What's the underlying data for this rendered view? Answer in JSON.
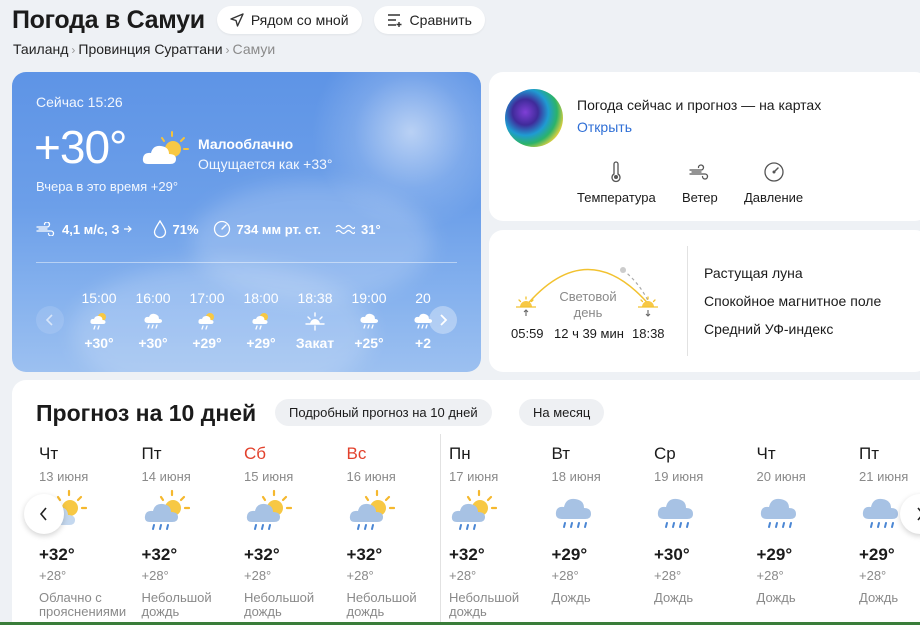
{
  "header": {
    "title": "Погода в Самуи",
    "nearby_label": "Рядом со мной",
    "compare_label": "Сравнить"
  },
  "breadcrumb": [
    "Таиланд",
    "Провинция Сураттани",
    "Самуи"
  ],
  "now": {
    "time": "Сейчас 15:26",
    "temp": "+30°",
    "condition": "Малооблачно",
    "feels_like": "Ощущается как +33°",
    "yesterday": "Вчера в это время +29°",
    "wind": "4,1 м/с, З",
    "humidity": "71%",
    "pressure": "734 мм рт. ст.",
    "water_temp": "31°",
    "hourly": [
      {
        "time": "15:00",
        "icon": "partly-cloudy-rain-icon",
        "temp": "+30°"
      },
      {
        "time": "16:00",
        "icon": "cloud-rain-icon",
        "temp": "+30°"
      },
      {
        "time": "17:00",
        "icon": "partly-cloudy-rain-icon",
        "temp": "+29°"
      },
      {
        "time": "18:00",
        "icon": "partly-cloudy-rain-icon",
        "temp": "+29°"
      },
      {
        "time": "18:38",
        "icon": "sunset-icon",
        "temp": "Закат"
      },
      {
        "time": "19:00",
        "icon": "cloud-rain-icon",
        "temp": "+25°"
      },
      {
        "time": "20",
        "icon": "cloud-rain-icon",
        "temp": "+2"
      }
    ]
  },
  "maps": {
    "title": "Погода сейчас и прогноз — на картах",
    "open_label": "Открыть",
    "layers": [
      "Температура",
      "Ветер",
      "Давление"
    ]
  },
  "sun": {
    "daylight_label": "Световой день",
    "sunrise": "05:59",
    "day_length": "12 ч 39 мин",
    "sunset": "18:38",
    "moon": "Растущая луна",
    "magnetic": "Спокойное магнитное поле",
    "uv": "Средний УФ-индекс"
  },
  "forecast": {
    "title": "Прогноз на 10 дней",
    "detailed_label": "Подробный прогноз на 10 дней",
    "month_label": "На месяц",
    "days": [
      {
        "name": "Чт",
        "date": "13 июня",
        "icon": "partly-cloudy-icon",
        "max": "+32°",
        "min": "+28°",
        "cond": "Облачно с прояснениями",
        "weekend": false
      },
      {
        "name": "Пт",
        "date": "14 июня",
        "icon": "partly-cloudy-rain-icon",
        "max": "+32°",
        "min": "+28°",
        "cond": "Небольшой дождь",
        "weekend": false
      },
      {
        "name": "Сб",
        "date": "15 июня",
        "icon": "partly-cloudy-rain-icon",
        "max": "+32°",
        "min": "+28°",
        "cond": "Небольшой дождь",
        "weekend": true
      },
      {
        "name": "Вс",
        "date": "16 июня",
        "icon": "partly-cloudy-rain-icon",
        "max": "+32°",
        "min": "+28°",
        "cond": "Небольшой дождь",
        "weekend": true
      },
      {
        "name": "Пн",
        "date": "17 июня",
        "icon": "partly-cloudy-rain-icon",
        "max": "+32°",
        "min": "+28°",
        "cond": "Небольшой дождь",
        "weekend": false
      },
      {
        "name": "Вт",
        "date": "18 июня",
        "icon": "cloud-rain-icon",
        "max": "+29°",
        "min": "+28°",
        "cond": "Дождь",
        "weekend": false
      },
      {
        "name": "Ср",
        "date": "19 июня",
        "icon": "cloud-rain-icon",
        "max": "+30°",
        "min": "+28°",
        "cond": "Дождь",
        "weekend": false
      },
      {
        "name": "Чт",
        "date": "20 июня",
        "icon": "cloud-rain-icon",
        "max": "+29°",
        "min": "+28°",
        "cond": "Дождь",
        "weekend": false
      },
      {
        "name": "Пт",
        "date": "21 июня",
        "icon": "cloud-rain-icon",
        "max": "+29°",
        "min": "+28°",
        "cond": "Дождь",
        "weekend": false
      }
    ]
  },
  "colors": {
    "accent": "#2f6fd6",
    "weekend": "#e2412c",
    "card_blue": "#6c9fe9"
  }
}
